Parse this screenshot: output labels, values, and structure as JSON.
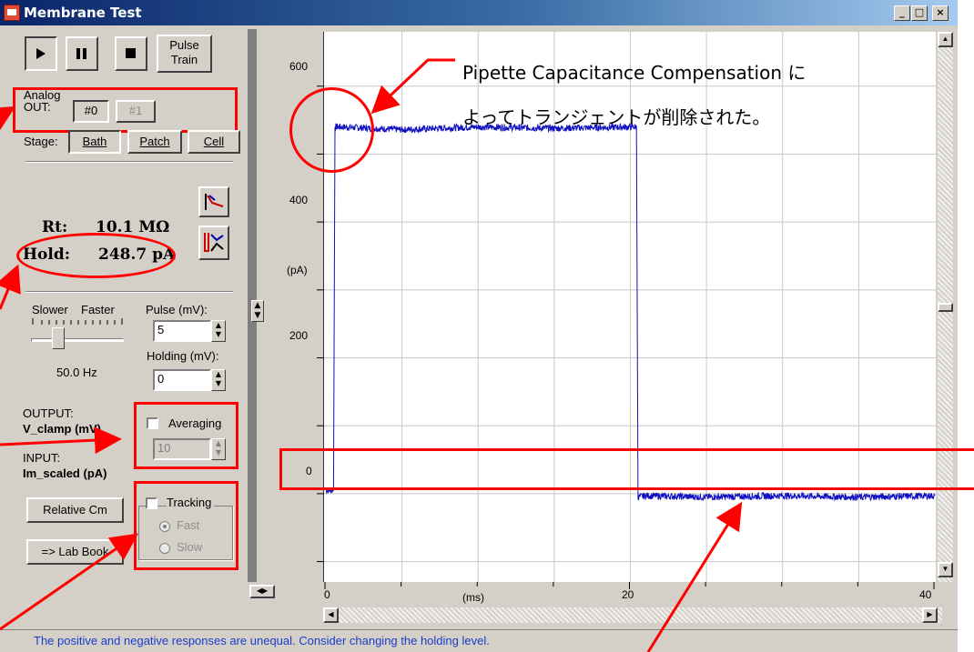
{
  "window": {
    "title": "Membrane Test",
    "controls": [
      "_",
      "□",
      "×"
    ]
  },
  "toolbar": {
    "play_icon": "play-icon",
    "pause_icon": "pause-icon",
    "stop_icon": "stop-icon",
    "pulse_train_label": "Pulse\nTrain"
  },
  "analog_out": {
    "label": "Analog\nOUT:",
    "options": [
      "#0",
      "#1"
    ],
    "selected": "#0"
  },
  "stage": {
    "label": "Stage:",
    "options": [
      "Bath",
      "Patch",
      "Cell"
    ],
    "selected": "Bath"
  },
  "readouts": {
    "rt_label": "Rt:",
    "rt_value": "10.1 MΩ",
    "hold_label": "Hold:",
    "hold_value": "248.7 pA"
  },
  "rate": {
    "slower_label": "Slower",
    "faster_label": "Faster",
    "value": "50.0 Hz",
    "level": 0.25
  },
  "pulse": {
    "label": "Pulse (mV):",
    "value": "5"
  },
  "holding": {
    "label": "Holding (mV):",
    "value": "0"
  },
  "output": {
    "label": "OUTPUT:",
    "value": "V_clamp (mV)"
  },
  "input": {
    "label": "INPUT:",
    "value": "Im_scaled (pA)"
  },
  "averaging": {
    "label": "Averaging",
    "value": "10",
    "checked": false
  },
  "tracking": {
    "label": "Tracking",
    "checked": false,
    "options": [
      "Fast",
      "Slow"
    ],
    "selected": "Fast"
  },
  "buttons": {
    "relative_cm": "Relative Cm",
    "lab_book": "=> Lab Book"
  },
  "plot": {
    "y_unit": "(pA)",
    "x_unit": "(ms)",
    "y_ticks": [
      "600",
      "400",
      "200",
      "0"
    ],
    "x_ticks": [
      "0",
      "20",
      "40"
    ]
  },
  "status_bar": "The positive and negative responses are unequal.  Consider changing the holding level.",
  "annotations": {
    "note_line1": "Pipette Capacitance Compensation に",
    "note_line2": "よってトランジェントが削除された。"
  },
  "chart_data": {
    "type": "line",
    "title": "",
    "xlabel": "(ms)",
    "ylabel": "(pA)",
    "xlim": [
      0,
      40
    ],
    "ylim": [
      -130,
      680
    ],
    "x": [
      0,
      0.5,
      0.6,
      1,
      5,
      10,
      15,
      20,
      20.4,
      20.5,
      21,
      25,
      30,
      35,
      40
    ],
    "series": [
      {
        "values": [
          5,
          5,
          540,
          540,
          536,
          540,
          538,
          540,
          540,
          -5,
          -3,
          -5,
          -3,
          -5,
          -3
        ]
      }
    ],
    "grid": true,
    "trace_color": "#1010c0"
  }
}
